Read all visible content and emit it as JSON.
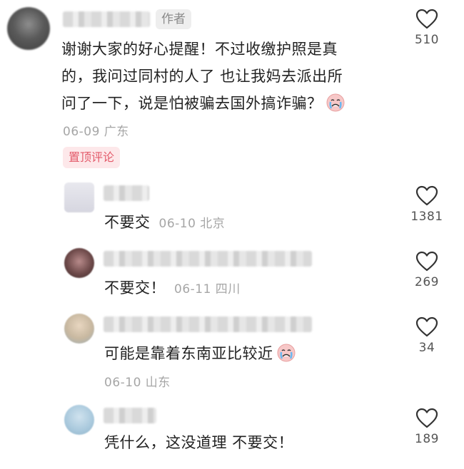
{
  "comments": [
    {
      "author_tag": "作者",
      "text_lines": [
        "谢谢大家的好心提醒！不过收缴护照是真",
        "的，我问过同村的人了 也让我妈去派出所",
        "问了一下，说是怕被骗去国外搞诈骗？"
      ],
      "emoji": "crying-face-emoji",
      "meta": "06-09 广东",
      "pinned_label": "置顶评论",
      "likes": "510"
    },
    {
      "text": "不要交",
      "meta": "06-10 北京",
      "likes": "1381"
    },
    {
      "text": "不要交！",
      "meta": "06-11 四川",
      "likes": "269"
    },
    {
      "text": "可能是靠着东南亚比较近",
      "emoji": "crying-face-emoji",
      "meta": "06-10 山东",
      "likes": "34"
    },
    {
      "text": "凭什么，这没道理 不要交！",
      "likes": "189"
    }
  ],
  "colors": {
    "pinned_bg": "#fde8ea",
    "pinned_text": "#e35a6a",
    "meta_text": "#a6a6a6"
  }
}
